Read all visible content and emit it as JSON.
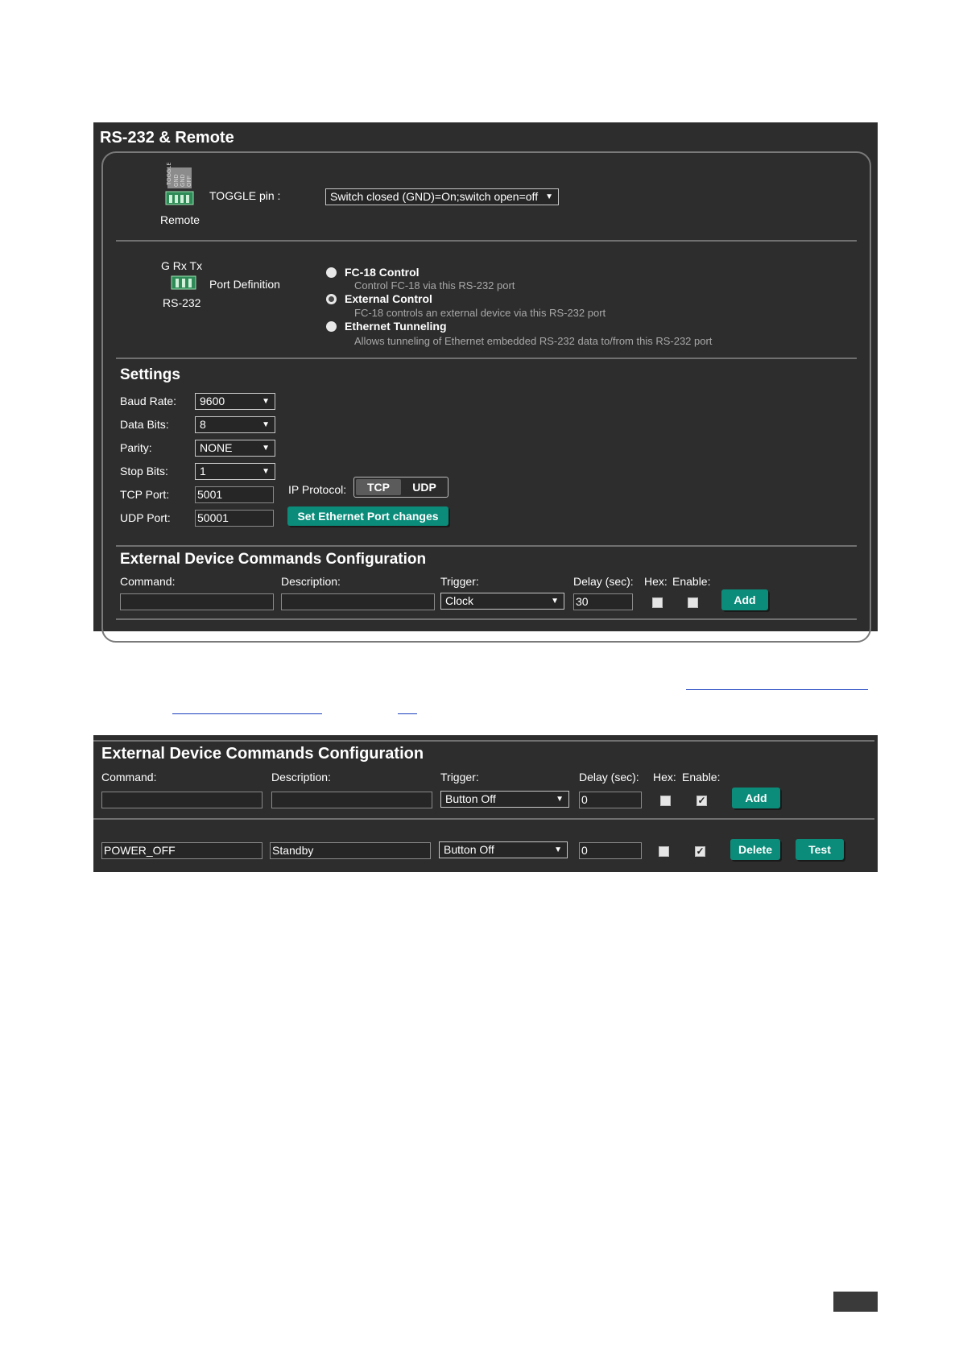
{
  "screenshot1": {
    "title": "RS-232 & Remote",
    "remote": {
      "icon_text": "TOGGLE GND GND OFF",
      "label": "Remote",
      "toggle_label": "TOGGLE pin :",
      "toggle_value": "Switch closed (GND)=On;switch open=off"
    },
    "rs232": {
      "pins_label": "G Rx Tx",
      "label": "RS-232",
      "port_def_label": "Port Definition",
      "options": [
        {
          "title": "FC-18 Control",
          "desc": "Control FC-18 via this RS-232 port",
          "selected": false
        },
        {
          "title": "External Control",
          "desc": "FC-18 controls an external device via this RS-232 port",
          "selected": true
        },
        {
          "title": "Ethernet Tunneling",
          "desc": "Allows tunneling of Ethernet embedded RS-232 data to/from this RS-232 port",
          "selected": false
        }
      ]
    },
    "settings": {
      "heading": "Settings",
      "baud_label": "Baud Rate:",
      "baud_value": "9600",
      "data_label": "Data Bits:",
      "data_value": "8",
      "parity_label": "Parity:",
      "parity_value": "NONE",
      "stop_label": "Stop Bits:",
      "stop_value": "1",
      "tcp_label": "TCP Port:",
      "tcp_value": "5001",
      "udp_label": "UDP Port:",
      "udp_value": "50001",
      "ip_protocol_label": "IP Protocol:",
      "tcp_btn": "TCP",
      "udp_btn": "UDP",
      "set_btn": "Set Ethernet Port changes"
    },
    "commands": {
      "heading": "External Device Commands Configuration",
      "command_label": "Command:",
      "description_label": "Description:",
      "trigger_label": "Trigger:",
      "delay_label": "Delay (sec):",
      "hex_label": "Hex:",
      "enable_label": "Enable:",
      "trigger_value": "Clock",
      "delay_value": "30",
      "hex_checked": false,
      "enable_checked": false,
      "add_btn": "Add"
    }
  },
  "screenshot2": {
    "heading": "External Device Commands Configuration",
    "command_label": "Command:",
    "description_label": "Description:",
    "trigger_label": "Trigger:",
    "delay_label": "Delay (sec):",
    "hex_label": "Hex:",
    "enable_label": "Enable:",
    "new_row": {
      "trigger": "Button Off",
      "delay": "0",
      "hex": false,
      "enable": true,
      "add_btn": "Add"
    },
    "saved_row": {
      "command": "POWER_OFF",
      "description": "Standby",
      "trigger": "Button Off",
      "delay": "0",
      "hex": false,
      "enable": true,
      "delete_btn": "Delete",
      "test_btn": "Test"
    }
  },
  "colors": {
    "panel": "#2d2d2d",
    "accent": "#0b8c7a",
    "link": "#1a3fbf"
  }
}
